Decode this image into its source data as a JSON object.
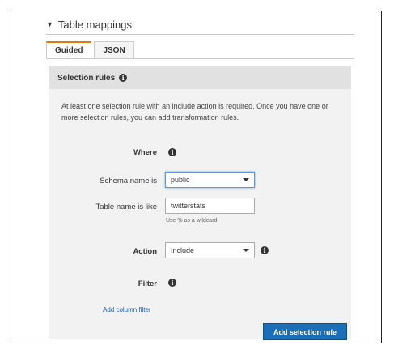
{
  "section": {
    "title": "Table mappings",
    "expanded": true
  },
  "tabs": [
    {
      "label": "Guided",
      "active": true
    },
    {
      "label": "JSON",
      "active": false
    }
  ],
  "panel": {
    "title": "Selection rules",
    "description": "At least one selection rule with an include action is required. Once you have one or more selection rules, you can add transformation rules."
  },
  "form": {
    "where_label": "Where",
    "schema": {
      "label": "Schema name is",
      "value": "public"
    },
    "table": {
      "label": "Table name is like",
      "value": "twitterstats",
      "hint": "Use % as a wildcard."
    },
    "action": {
      "label": "Action",
      "value": "Include"
    },
    "filter": {
      "label": "Filter"
    },
    "add_filter_label": "Add column filter",
    "add_rule_label": "Add selection rule"
  },
  "icons": {
    "info": "i",
    "info_icon": "info-circle-icon",
    "caret_icon": "caret-down-icon"
  },
  "colors": {
    "tab_accent": "#e47911",
    "primary_button": "#1a6fb8",
    "link": "#1a5fa8",
    "focus_border": "#5a9bd5"
  }
}
